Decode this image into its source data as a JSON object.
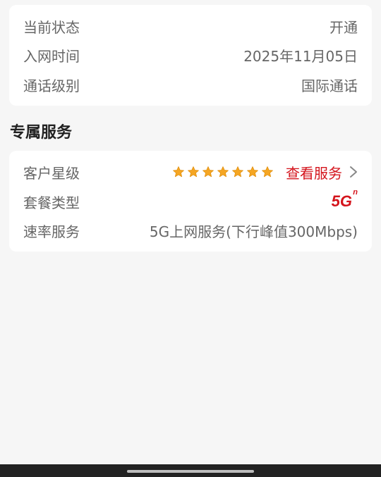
{
  "status_card": {
    "rows": [
      {
        "label": "当前状态",
        "value": "开通"
      },
      {
        "label": "入网时间",
        "value": "2025年11月05日"
      },
      {
        "label": "通话级别",
        "value": "国际通话"
      }
    ]
  },
  "services": {
    "title": "专属服务",
    "customer_level": {
      "label": "客户星级",
      "stars": 7,
      "link": "查看服务"
    },
    "package_type": {
      "label": "套餐类型",
      "badge": "5G",
      "badge_sup": "n"
    },
    "rate_service": {
      "label": "速率服务",
      "value": "5G上网服务(下行峰值300Mbps)"
    }
  },
  "colors": {
    "accent": "#d4141c",
    "star": "#f5a623",
    "text_muted": "#666666",
    "background": "#f6f6f6"
  }
}
